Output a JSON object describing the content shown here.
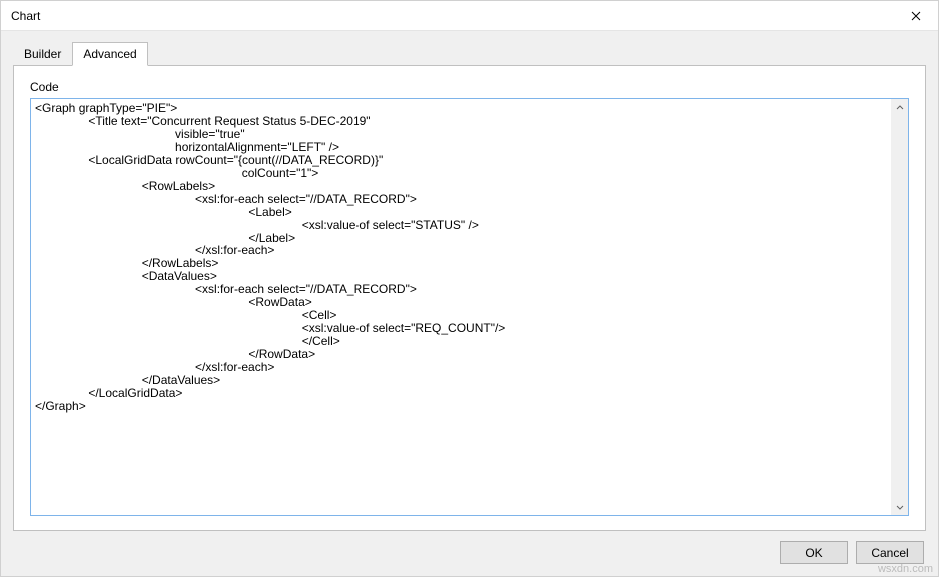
{
  "dialog": {
    "title": "Chart"
  },
  "tabs": {
    "builder": "Builder",
    "advanced": "Advanced"
  },
  "panel": {
    "code_label": "Code",
    "code_content": "<Graph graphType=\"PIE\">\n                <Title text=\"Concurrent Request Status 5-DEC-2019\"\n                                          visible=\"true\"\n                                          horizontalAlignment=\"LEFT\" />\n                <LocalGridData rowCount=\"{count(//DATA_RECORD)}\"\n                                                              colCount=\"1\">\n                                <RowLabels>\n                                                <xsl:for-each select=\"//DATA_RECORD\">\n                                                                <Label>\n                                                                                <xsl:value-of select=\"STATUS\" />\n                                                                </Label>\n                                                </xsl:for-each>\n                                </RowLabels>\n                                <DataValues>\n                                                <xsl:for-each select=\"//DATA_RECORD\">\n                                                                <RowData>\n                                                                                <Cell>\n                                                                                <xsl:value-of select=\"REQ_COUNT\"/>\n                                                                                </Cell>\n                                                                </RowData>\n                                                </xsl:for-each>\n                                </DataValues>\n                </LocalGridData>\n</Graph>"
  },
  "buttons": {
    "ok": "OK",
    "cancel": "Cancel"
  },
  "watermark": "wsxdn.com"
}
